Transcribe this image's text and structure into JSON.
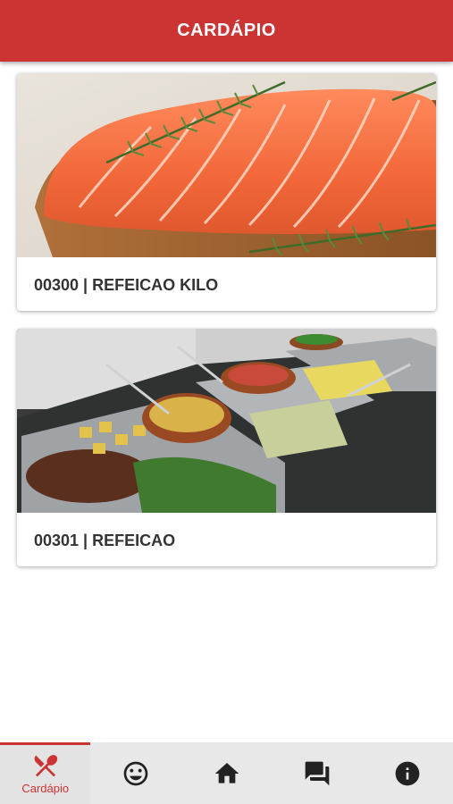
{
  "header": {
    "title": "CARDÁPIO"
  },
  "menu_items": [
    {
      "title": "00300 | REFEICAO KILO",
      "image_icon": "salmon-photo"
    },
    {
      "title": "00301 | REFEICAO",
      "image_icon": "buffet-photo"
    }
  ],
  "bottom_nav": {
    "active_index": 0,
    "items": [
      {
        "icon": "fork-knife-icon",
        "label": "Cardápio"
      },
      {
        "icon": "smiley-icon",
        "label": ""
      },
      {
        "icon": "home-icon",
        "label": ""
      },
      {
        "icon": "chat-icon",
        "label": ""
      },
      {
        "icon": "info-icon",
        "label": ""
      }
    ]
  },
  "colors": {
    "primary": "#cc3333",
    "nav_background": "#e8e8e8",
    "title_text": "#333333",
    "icon_dark": "#222222"
  }
}
